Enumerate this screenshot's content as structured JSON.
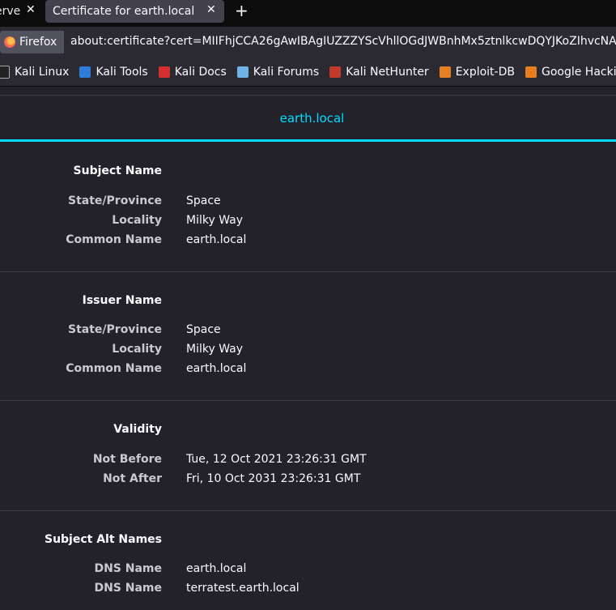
{
  "browser": {
    "tabs": [
      {
        "title": "erve",
        "active": false
      },
      {
        "title": "Certificate for earth.local",
        "active": true
      }
    ],
    "close_glyph": "✕",
    "new_tab_glyph": "+",
    "identity_label": "Firefox",
    "url": "about:certificate?cert=MIIFhjCCA26gAwIBAgIUZZZYScVhllOGdJWBnhMx5ztnlkcwDQYJKoZIhvcNA"
  },
  "bookmarks": [
    {
      "label": "Kali Linux",
      "icon": "kali-dragon-icon"
    },
    {
      "label": "Kali Tools",
      "icon": "kali-tools-icon"
    },
    {
      "label": "Kali Docs",
      "icon": "kali-docs-icon"
    },
    {
      "label": "Kali Forums",
      "icon": "kali-forums-icon"
    },
    {
      "label": "Kali NetHunter",
      "icon": "kali-nethunter-icon"
    },
    {
      "label": "Exploit-DB",
      "icon": "exploit-db-icon"
    },
    {
      "label": "Google Hacking DB",
      "icon": "ghdb-icon"
    }
  ],
  "certificate": {
    "title": "earth.local",
    "accent_color": "#00ddff",
    "sections": [
      {
        "heading": "Subject Name",
        "rows": [
          {
            "label": "State/Province",
            "value": "Space"
          },
          {
            "label": "Locality",
            "value": "Milky Way"
          },
          {
            "label": "Common Name",
            "value": "earth.local"
          }
        ]
      },
      {
        "heading": "Issuer Name",
        "rows": [
          {
            "label": "State/Province",
            "value": "Space"
          },
          {
            "label": "Locality",
            "value": "Milky Way"
          },
          {
            "label": "Common Name",
            "value": "earth.local"
          }
        ]
      },
      {
        "heading": "Validity",
        "rows": [
          {
            "label": "Not Before",
            "value": "Tue, 12 Oct 2021 23:26:31 GMT"
          },
          {
            "label": "Not After",
            "value": "Fri, 10 Oct 2031 23:26:31 GMT"
          }
        ]
      },
      {
        "heading": "Subject Alt Names",
        "rows": [
          {
            "label": "DNS Name",
            "value": "earth.local"
          },
          {
            "label": "DNS Name",
            "value": "terratest.earth.local"
          }
        ]
      }
    ]
  }
}
